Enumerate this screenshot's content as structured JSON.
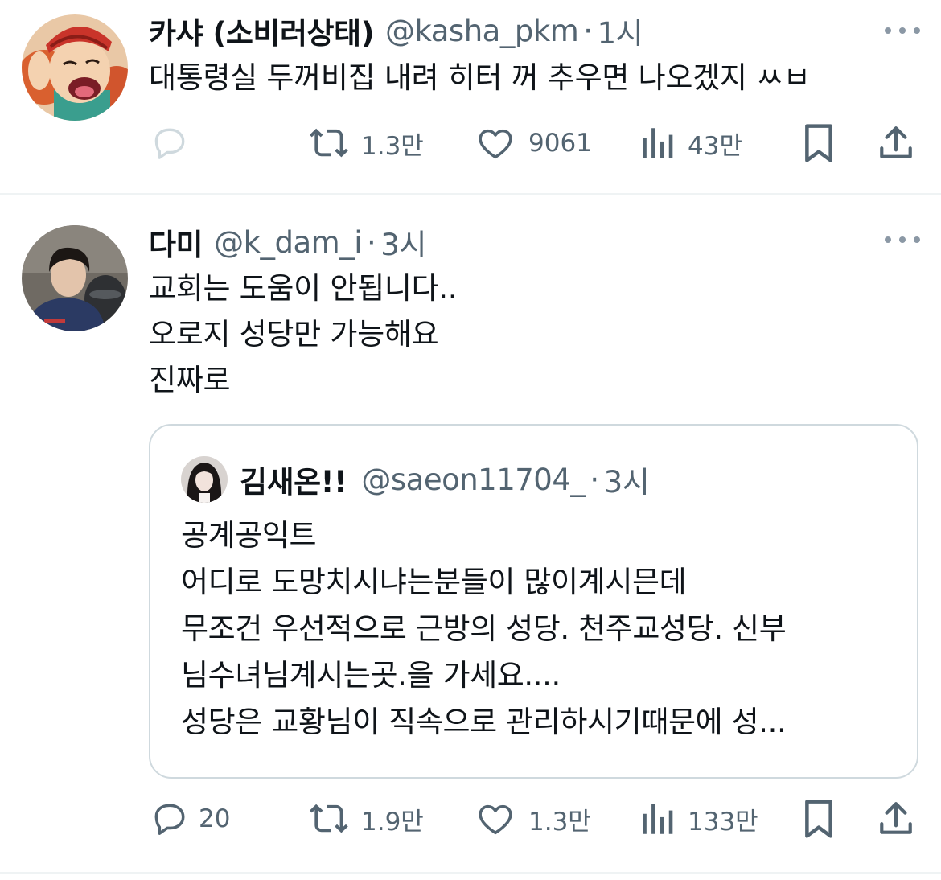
{
  "tweets": [
    {
      "name": "카샤 (소비러상태)",
      "handle": "@kasha_pkm",
      "time": "1시",
      "avatar_icon": "cartoon-avatar",
      "text_lines": [
        "대통령실 두꺼비집 내려 히터 꺼 추우면 나오겠지 ㅆㅂ"
      ],
      "stats": {
        "replies": "",
        "retweets": "1.3만",
        "likes": "9061",
        "views": "43만"
      }
    },
    {
      "name": "다미",
      "handle": "@k_dam_i",
      "time": "3시",
      "avatar_icon": "photo-avatar",
      "text_lines": [
        "교회는 도움이 안됩니다..",
        "오로지 성당만 가능해요",
        "진짜로"
      ],
      "quote": {
        "name": "김새온!!",
        "handle": "@saeon11704_",
        "time": "3시",
        "text_lines": [
          "공계공익트",
          "어디로 도망치시냐는분들이 많이계시믄데",
          "무조건 우선적으로 근방의 성당. 천주교성당. 신부",
          "님수녀님계시는곳.을 가세요....",
          "성당은 교황님이 직속으로 관리하시기때문에 성..."
        ]
      },
      "stats": {
        "replies": "20",
        "retweets": "1.9만",
        "likes": "1.3만",
        "views": "133만"
      }
    }
  ],
  "separator": "·",
  "colors": {
    "text": "#0f1419",
    "secondary": "#536471",
    "border": "#cfd9de",
    "divider": "#eff3f4"
  },
  "icons": [
    "reply-icon",
    "retweet-icon",
    "like-icon",
    "views-icon",
    "bookmark-icon",
    "share-icon",
    "more-icon"
  ]
}
